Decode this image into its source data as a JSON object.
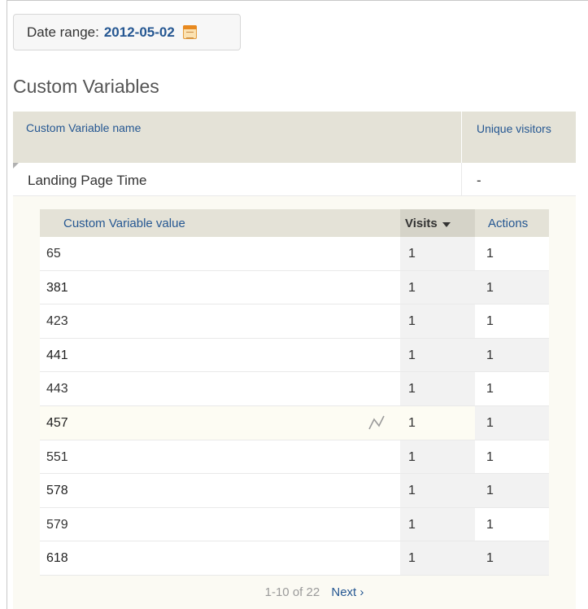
{
  "date_range": {
    "label": "Date range:",
    "value": "2012-05-02"
  },
  "section_title": "Custom Variables",
  "outer_table": {
    "headers": {
      "name": "Custom Variable name",
      "unique_visitors": "Unique visitors"
    },
    "row": {
      "name": "Landing Page Time",
      "unique_visitors": "-"
    }
  },
  "sub_table": {
    "headers": {
      "value": "Custom Variable value",
      "visits": "Visits",
      "actions": "Actions"
    },
    "rows": [
      {
        "value": "65",
        "visits": "1",
        "actions": "1"
      },
      {
        "value": "381",
        "visits": "1",
        "actions": "1"
      },
      {
        "value": "423",
        "visits": "1",
        "actions": "1"
      },
      {
        "value": "441",
        "visits": "1",
        "actions": "1"
      },
      {
        "value": "443",
        "visits": "1",
        "actions": "1"
      },
      {
        "value": "457",
        "visits": "1",
        "actions": "1"
      },
      {
        "value": "551",
        "visits": "1",
        "actions": "1"
      },
      {
        "value": "578",
        "visits": "1",
        "actions": "1"
      },
      {
        "value": "579",
        "visits": "1",
        "actions": "1"
      },
      {
        "value": "618",
        "visits": "1",
        "actions": "1"
      }
    ],
    "hovered_row_icon": "row-evolution-icon"
  },
  "pagination": {
    "range": "1-10 of 22",
    "next": "Next ›"
  },
  "colors": {
    "link": "#255792",
    "header_bg": "#e4e2d7",
    "sorted_col_bg": "#d5d3c8"
  }
}
